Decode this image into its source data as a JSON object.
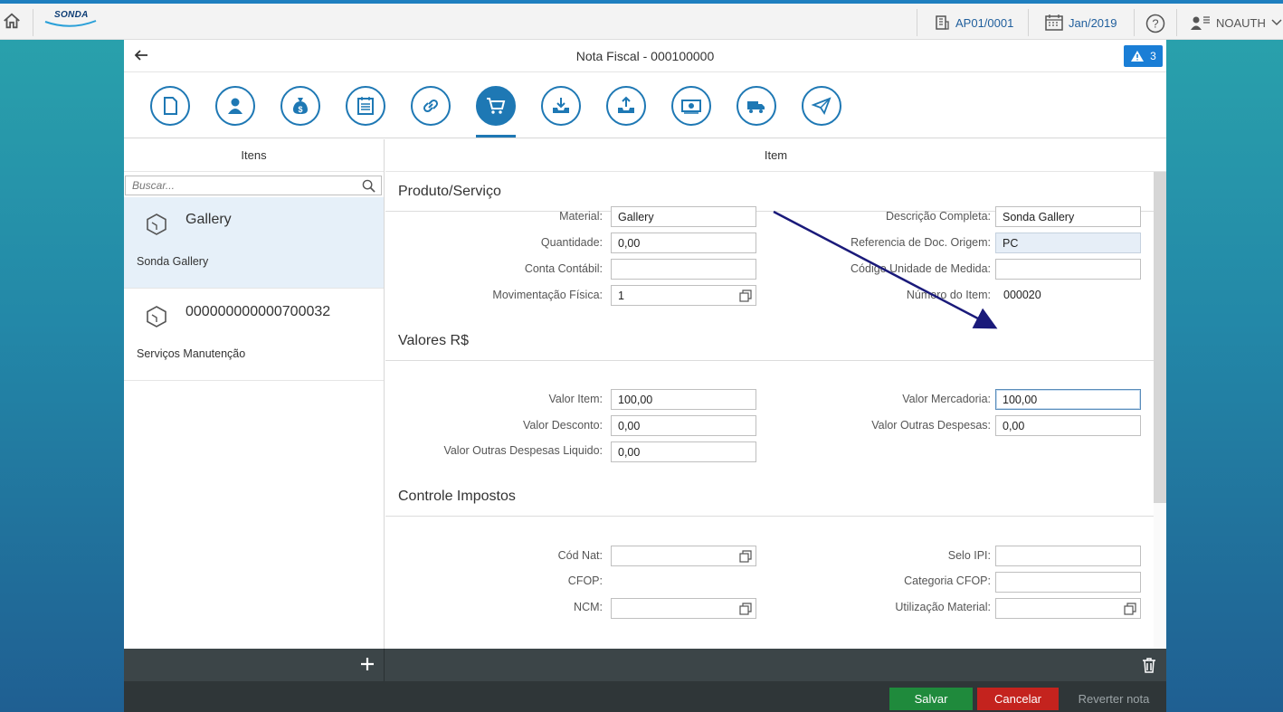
{
  "shell": {
    "home_icon": "home-icon",
    "logo_text": "SONDA",
    "company": "AP01/0001",
    "period": "Jan/2019",
    "help_icon": "question-circle-icon",
    "user": "NOAUTH"
  },
  "page": {
    "title": "Nota Fiscal - 000100000",
    "warning_count": "3"
  },
  "tabs": [
    {
      "name": "document-icon"
    },
    {
      "name": "person-icon"
    },
    {
      "name": "money-bag-icon"
    },
    {
      "name": "calendar-list-icon"
    },
    {
      "name": "link-icon"
    },
    {
      "name": "cart-icon",
      "active": true
    },
    {
      "name": "download-tray-icon"
    },
    {
      "name": "upload-tray-icon"
    },
    {
      "name": "banknote-icon"
    },
    {
      "name": "truck-icon"
    },
    {
      "name": "paper-plane-icon"
    }
  ],
  "items_panel": {
    "header": "Itens",
    "search_placeholder": "Buscar...",
    "items": [
      {
        "title": "Gallery",
        "subtitle": "Sonda Gallery"
      },
      {
        "title": "000000000000700032",
        "subtitle": "Serviços Manutenção"
      }
    ]
  },
  "detail": {
    "header": "Item",
    "section_produto": "Produto/Serviço",
    "material_label": "Material:",
    "material_value": "Gallery",
    "quantidade_label": "Quantidade:",
    "quantidade_value": "0,00",
    "conta_label": "Conta Contábil:",
    "conta_value": "",
    "mov_label": "Movimentação Física:",
    "mov_value": "1",
    "desc_label": "Descrição Completa:",
    "desc_value": "Sonda Gallery",
    "ref_label": "Referencia de Doc. Origem:",
    "ref_value": "PC",
    "unid_label": "Código Unidade de Medida:",
    "unid_value": "",
    "num_label": "Número do Item:",
    "num_value": "000020",
    "section_valores": "Valores R$",
    "valor_item_label": "Valor Item:",
    "valor_item_value": "100,00",
    "valor_desc_label": "Valor Desconto:",
    "valor_desc_value": "0,00",
    "valor_outras_liq_label": "Valor Outras Despesas Liquido:",
    "valor_outras_liq_value": "0,00",
    "valor_merc_label": "Valor Mercadoria:",
    "valor_merc_value": "100,00",
    "valor_outras_label": "Valor Outras Despesas:",
    "valor_outras_value": "0,00",
    "section_impostos": "Controle Impostos",
    "cod_nat_label": "Cód Nat:",
    "cfop_label": "CFOP:",
    "ncm_label": "NCM:",
    "selo_label": "Selo IPI:",
    "cat_cfop_label": "Categoria CFOP:",
    "util_label": "Utilização Material:"
  },
  "footer": {
    "save": "Salvar",
    "cancel": "Cancelar",
    "revert": "Reverter nota"
  },
  "colors": {
    "accent": "#1e78b4",
    "save": "#1f8a3c",
    "cancel": "#c4231e",
    "annotation_arrow": "#1a1a7a"
  }
}
